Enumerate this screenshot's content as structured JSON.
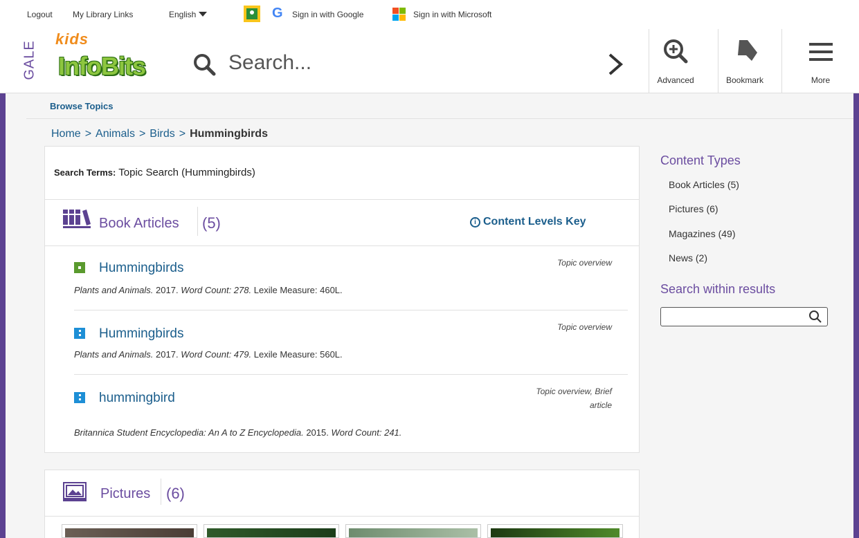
{
  "topbar": {
    "logout": "Logout",
    "library_links": "My Library Links",
    "language": "English",
    "sign_in_google": "Sign in with Google",
    "sign_in_microsoft": "Sign in with Microsoft"
  },
  "header": {
    "brand_gale": "GALE",
    "brand_kids": "kids",
    "brand_infobits": "InfoBits",
    "search_placeholder": "Search...",
    "advanced_label": "Advanced",
    "bookmark_label": "Bookmark",
    "more_label": "More"
  },
  "nav": {
    "browse_topics": "Browse Topics"
  },
  "breadcrumb": {
    "home": "Home",
    "animals": "Animals",
    "birds": "Birds",
    "current": "Hummingbirds",
    "separator": ">"
  },
  "search_terms": {
    "label": "Search Terms:",
    "value": "Topic Search (Hummingbirds)"
  },
  "book_articles": {
    "title": "Book Articles",
    "count": "(5)",
    "content_levels_key": "Content Levels Key",
    "items": [
      {
        "title": "Hummingbirds",
        "source": "Plants and Animals.",
        "year": "2017.",
        "word_count_label": "Word Count: 278.",
        "lexile": "Lexile Measure: 460L.",
        "type": "Topic overview",
        "level_color": "#5a9a2e"
      },
      {
        "title": "Hummingbirds",
        "source": "Plants and Animals.",
        "year": "2017.",
        "word_count_label": "Word Count: 479.",
        "lexile": "Lexile Measure: 560L.",
        "type": "Topic overview",
        "level_color": "#1e8fd6"
      },
      {
        "title": "hummingbird",
        "source": "Britannica Student Encyclopedia: An A to Z Encyclopedia.",
        "year": "2015.",
        "word_count_label": "Word Count: 241.",
        "lexile": "",
        "type_line1": "Topic overview, Brief",
        "type_line2": "article",
        "level_color": "#1e8fd6"
      }
    ]
  },
  "pictures": {
    "title": "Pictures",
    "count": "(6)"
  },
  "sidebar": {
    "content_types_title": "Content Types",
    "content_types": [
      {
        "label": "Book Articles (5)"
      },
      {
        "label": "Pictures (6)"
      },
      {
        "label": "Magazines (49)"
      },
      {
        "label": "News (2)"
      }
    ],
    "search_within_title": "Search within results",
    "search_within_value": ""
  },
  "colors": {
    "brand_purple": "#5c4291",
    "link_blue": "#1b5e8c",
    "heading_purple": "#6b4da0"
  }
}
